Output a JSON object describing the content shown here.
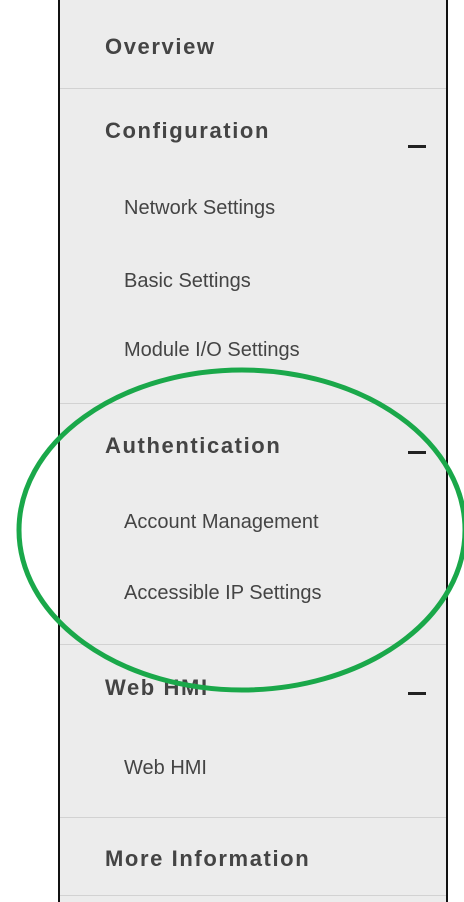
{
  "nav": {
    "overview": "Overview",
    "configuration": {
      "label": "Configuration",
      "items": [
        "Network Settings",
        "Basic Settings",
        "Module I/O Settings"
      ]
    },
    "authentication": {
      "label": "Authentication",
      "items": [
        "Account Management",
        "Accessible IP Settings"
      ]
    },
    "web_hmi": {
      "label": "Web HMI",
      "items": [
        "Web HMI"
      ]
    },
    "more_information": "More Information"
  },
  "annotation": {
    "color": "#1aa84a",
    "shape": "ellipse",
    "target": "Authentication"
  }
}
